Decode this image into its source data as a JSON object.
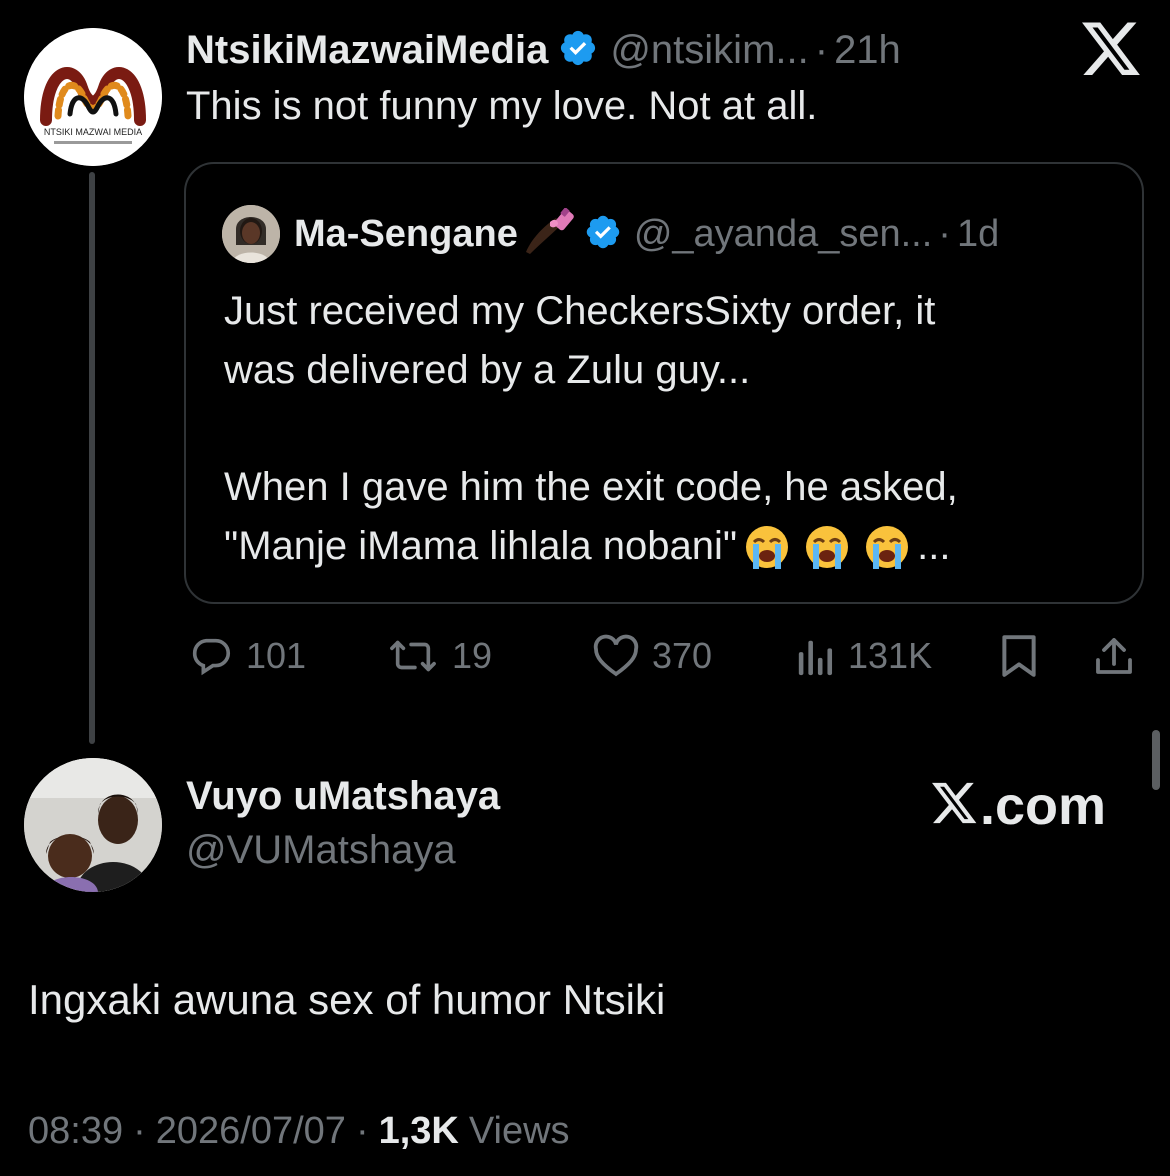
{
  "parent": {
    "name": "NtsikiMazwaiMedia",
    "handle": "@ntsikim...",
    "dot": "·",
    "time": "21h",
    "text": "This is not funny my love. Not at all.",
    "logo_text": "NTSIKI MAZWAI MEDIA",
    "close_icon": "x-logo-icon"
  },
  "quote": {
    "name": "Ma-Sengane",
    "handle": "@_ayanda_sen...",
    "dot": "·",
    "time": "1d",
    "lines": [
      "Just received my CheckersSixty order, it",
      "was delivered by a Zulu guy..."
    ],
    "line3": "When I gave him the exit code, he asked,",
    "line4": "\"Manje iMama lihlala nobani\"",
    "line4_end": "..."
  },
  "actions": {
    "replies": "101",
    "reposts": "19",
    "likes": "370",
    "views": "131K"
  },
  "reply": {
    "name": "Vuyo uMatshaya",
    "handle": "@VUMatshaya",
    "watermark": ".com",
    "text": "Ingxaki awuna sex of humor Ntsiki",
    "time": "08:39",
    "date": "2026/07/07",
    "views_count": "1,3K",
    "views_label": "Views",
    "sep": "·"
  },
  "colors": {
    "background": "#000000",
    "text": "#e7e9ea",
    "muted": "#71767b",
    "verified": "#1d9bf0",
    "border": "#2f3336"
  }
}
